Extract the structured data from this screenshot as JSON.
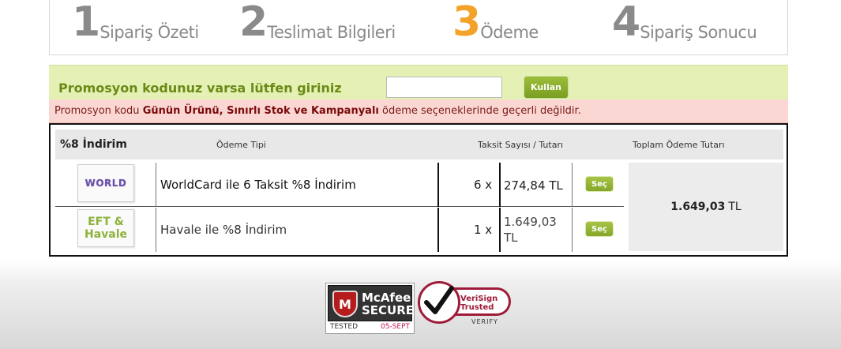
{
  "steps": [
    {
      "num": "1",
      "label": "Sipariş Özeti",
      "active": false
    },
    {
      "num": "2",
      "label": "Teslimat Bilgileri",
      "active": false
    },
    {
      "num": "3",
      "label": "Ödeme",
      "active": true
    },
    {
      "num": "4",
      "label": "Sipariş Sonucu",
      "active": false
    }
  ],
  "promo": {
    "label": "Promosyon kodunuz varsa lütfen giriniz",
    "input_value": "",
    "button_label": "Kullan"
  },
  "warning": {
    "prefix": "Promosyon kodu ",
    "bold": "Günün Ürünü, Sınırlı Stok ve Kampanyalı",
    "suffix": " ödeme seçeneklerinde geçerli değildir."
  },
  "payment_table": {
    "title": "%8 İndirim",
    "col_payment_type": "Ödeme Tipi",
    "col_installments": "Taksit Sayısı / Tutarı",
    "col_total": "Toplam Ödeme Tutarı",
    "rows": [
      {
        "logo_text": "WORLD",
        "name": "WorldCard ile 6 Taksit %8 İndirim",
        "multiplier": "6 x",
        "amount": "274,84 TL",
        "button_label": "Seç"
      },
      {
        "logo_text_line1": "EFT &",
        "logo_text_line2": "Havale",
        "name": "Havale ile %8 İndirim",
        "multiplier": "1 x",
        "amount": "1.649,03 TL",
        "button_label": "Seç"
      }
    ],
    "total_value": "1.649,03",
    "total_currency": "TL"
  },
  "badges": {
    "mcafee": {
      "brand": "McAfee",
      "secure": "SECURE",
      "tested": "TESTED",
      "date": "05-SEPT"
    },
    "verisign": {
      "line1": "VeriSign",
      "line2": "Trusted",
      "verify": "VERIFY"
    }
  },
  "colors": {
    "active_step": "#f3a22a",
    "promo_bg": "#e4f0b4",
    "warning_bg": "#fbd7d4",
    "button_green": "#86a62a"
  }
}
